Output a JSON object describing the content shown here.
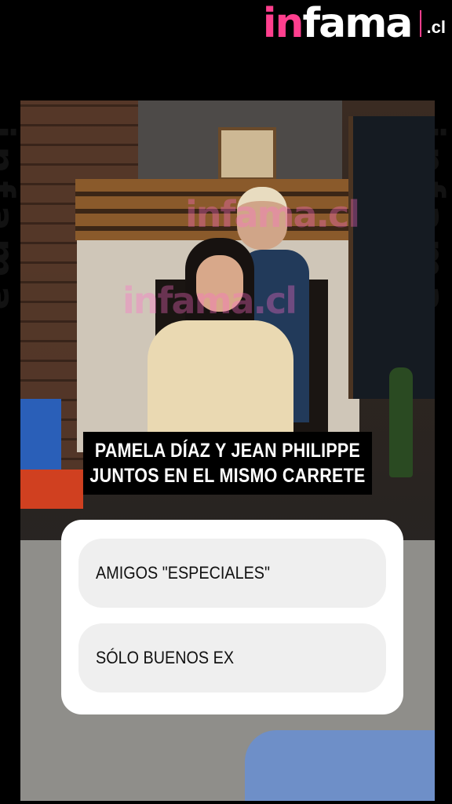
{
  "brand": {
    "logo_in": "in",
    "logo_fama": "fama",
    "logo_tld": ".cl",
    "accent_color": "#ff3f8e"
  },
  "story": {
    "caption_line1": "PAMELA DÍAZ Y JEAN PHILIPPE",
    "caption_line2": "JUNTOS EN EL MISMO CARRETE",
    "poll": {
      "options": [
        {
          "label": "AMIGOS \"ESPECIALES\""
        },
        {
          "label": "SÓLO BUENOS EX"
        }
      ]
    },
    "photo_watermark": "infama.cl"
  }
}
